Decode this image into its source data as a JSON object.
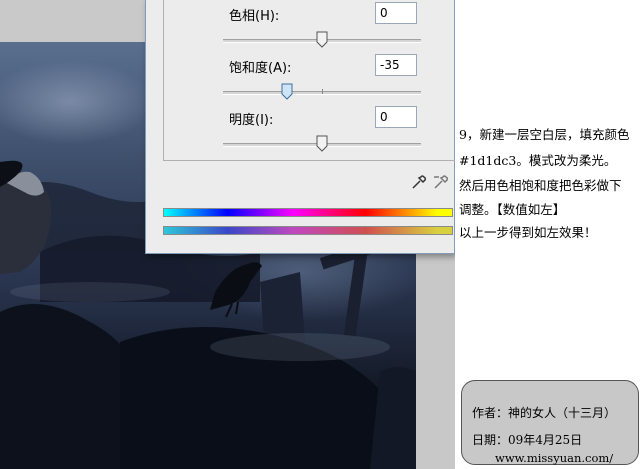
{
  "dialog": {
    "params": [
      {
        "label": "色相(H):",
        "value": "0",
        "level_pct": 50
      },
      {
        "label": "饱和度(A):",
        "value": "-35",
        "level_pct": 32.5
      },
      {
        "label": "明度(I):",
        "value": "0",
        "level_pct": 50
      }
    ],
    "eyedropper_icons": [
      "eyedropper-icon",
      "eyedropper-minus-icon"
    ]
  },
  "tutorial": {
    "lines": [
      "9，新建一层空白层，填充颜色",
      "#1d1dc3。模式改为柔光。",
      "然后用色相饱和度把色彩做下",
      "调整。【数值如左】",
      "以上一步得到如左效果！"
    ]
  },
  "credit": {
    "author": "作者：神的女人（十三月）",
    "date": "日期：09年4月25日",
    "url": "www.missyuan.com/"
  },
  "colors": {
    "dialog_bg": "#ececec",
    "dialog_frame": "#cfe0ee",
    "credit_bg": "#c8c8c8"
  }
}
